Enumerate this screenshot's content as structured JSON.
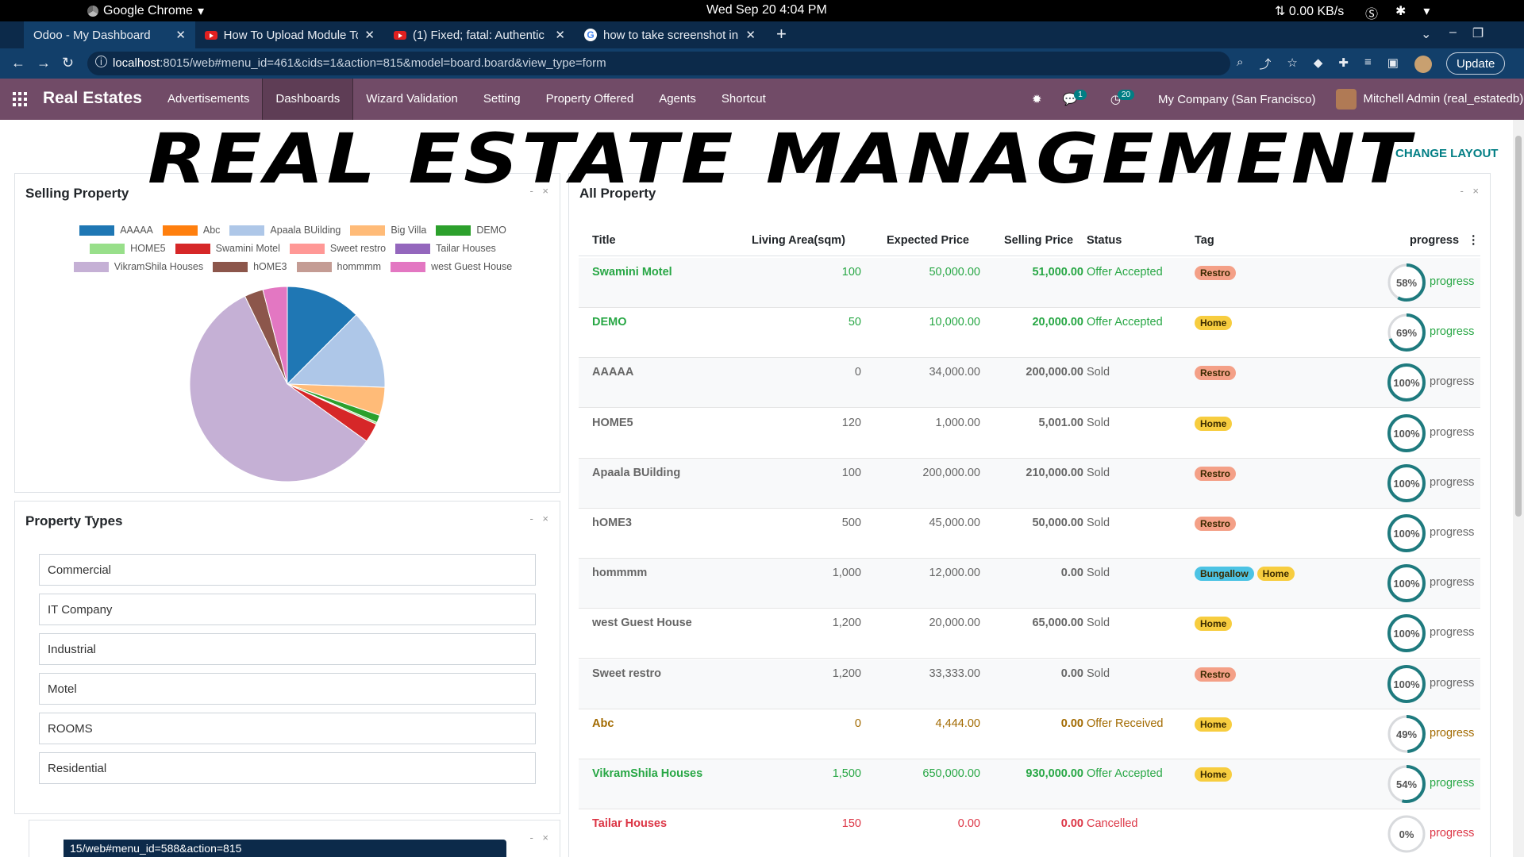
{
  "os": {
    "app_name": "Google Chrome",
    "clock": "Wed Sep 20   4:04 PM",
    "net_speed": "0.00 KB/s"
  },
  "browser": {
    "tabs": [
      {
        "title": "Odoo - My Dashboard",
        "icon": "odoo-icon",
        "active": true
      },
      {
        "title": "How To Upload Module To",
        "icon": "youtube-icon",
        "active": false
      },
      {
        "title": "(1) Fixed; fatal: Authentic",
        "icon": "youtube-icon",
        "active": false
      },
      {
        "title": "how to take screenshot in",
        "icon": "google-icon",
        "active": false
      }
    ],
    "url_host": "localhost",
    "url_rest": ":8015/web#menu_id=461&cids=1&action=815&model=board.board&view_type=form",
    "update_label": "Update"
  },
  "navbar": {
    "brand": "Real Estates",
    "menu": [
      "Advertisements",
      "Dashboards",
      "Wizard Validation",
      "Setting",
      "Property Offered",
      "Agents",
      "Shortcut"
    ],
    "active_menu": "Dashboards",
    "chat_badge": "1",
    "activity_badge": "20",
    "company": "My Company (San Francisco)",
    "user": "Mitchell Admin (real_estatedb)"
  },
  "overlay_title": "REAL ESTATE MANAGEMENT",
  "change_layout_label": "CHANGE LAYOUT",
  "selling_panel": {
    "title": "Selling Property",
    "controls": "- ×"
  },
  "chart_data": {
    "type": "pie",
    "title": "",
    "legend_position": "top",
    "categories": [
      "AAAAA",
      "Abc",
      "Apaala BUilding",
      "Big Villa",
      "DEMO",
      "HOME5",
      "Swamini Motel",
      "Sweet  restro",
      "Tailar Houses",
      "VikramShila Houses",
      "hOME3",
      "hommmm",
      "west Guest House"
    ],
    "values": [
      200000,
      0,
      210000,
      75000,
      20000,
      5001,
      51000,
      0,
      0,
      930000,
      50000,
      0,
      65000
    ],
    "colors": [
      "#1f77b4",
      "#ff7f0e",
      "#aec7e8",
      "#ffbb78",
      "#2ca02c",
      "#98df8a",
      "#d62728",
      "#ff9896",
      "#9467bd",
      "#c5b0d5",
      "#8c564b",
      "#c49c94",
      "#e377c2"
    ]
  },
  "types_panel": {
    "title": "Property Types",
    "controls": "- ×",
    "items": [
      "Commercial",
      "IT Company",
      "Industrial",
      "Motel",
      "ROOMS",
      "Residential"
    ]
  },
  "third_panel": {
    "controls": "- ×"
  },
  "all_panel": {
    "title": "All Property",
    "controls": "- ×",
    "columns": {
      "title": "Title",
      "living_area": "Living Area(sqm)",
      "expected_price": "Expected Price",
      "selling_price": "Selling Price",
      "status": "Status",
      "tag": "Tag",
      "progress": "progress"
    },
    "rows": [
      {
        "title": "Swamini Motel",
        "living_area": "100",
        "expected_price": "50,000.00",
        "selling_price": "51,000.00",
        "status": "Offer Accepted",
        "tags": [
          "Restro"
        ],
        "progress": 58,
        "progress_text": "58%",
        "progress_label": "progress",
        "tone": "green"
      },
      {
        "title": "DEMO",
        "living_area": "50",
        "expected_price": "10,000.00",
        "selling_price": "20,000.00",
        "status": "Offer Accepted",
        "tags": [
          "Home"
        ],
        "progress": 69,
        "progress_text": "69%",
        "progress_label": "progress",
        "tone": "green"
      },
      {
        "title": "AAAAA",
        "living_area": "0",
        "expected_price": "34,000.00",
        "selling_price": "200,000.00",
        "status": "Sold",
        "tags": [
          "Restro"
        ],
        "progress": 100,
        "progress_text": "100%",
        "progress_label": "progress",
        "tone": "grey"
      },
      {
        "title": "HOME5",
        "living_area": "120",
        "expected_price": "1,000.00",
        "selling_price": "5,001.00",
        "status": "Sold",
        "tags": [
          "Home"
        ],
        "progress": 100,
        "progress_text": "100%",
        "progress_label": "progress",
        "tone": "grey"
      },
      {
        "title": "Apaala BUilding",
        "living_area": "100",
        "expected_price": "200,000.00",
        "selling_price": "210,000.00",
        "status": "Sold",
        "tags": [
          "Restro"
        ],
        "progress": 100,
        "progress_text": "100%",
        "progress_label": "progress",
        "tone": "grey"
      },
      {
        "title": "hOME3",
        "living_area": "500",
        "expected_price": "45,000.00",
        "selling_price": "50,000.00",
        "status": "Sold",
        "tags": [
          "Restro"
        ],
        "progress": 100,
        "progress_text": "100%",
        "progress_label": "progress",
        "tone": "grey"
      },
      {
        "title": "hommmm",
        "living_area": "1,000",
        "expected_price": "12,000.00",
        "selling_price": "0.00",
        "status": "Sold",
        "tags": [
          "Bungallow",
          "Home"
        ],
        "progress": 100,
        "progress_text": "100%",
        "progress_label": "progress",
        "tone": "grey"
      },
      {
        "title": "west Guest House",
        "living_area": "1,200",
        "expected_price": "20,000.00",
        "selling_price": "65,000.00",
        "status": "Sold",
        "tags": [
          "Home"
        ],
        "progress": 100,
        "progress_text": "100%",
        "progress_label": "progress",
        "tone": "grey"
      },
      {
        "title": "Sweet restro",
        "living_area": "1,200",
        "expected_price": "33,333.00",
        "selling_price": "0.00",
        "status": "Sold",
        "tags": [
          "Restro"
        ],
        "progress": 100,
        "progress_text": "100%",
        "progress_label": "progress",
        "tone": "grey"
      },
      {
        "title": "Abc",
        "living_area": "0",
        "expected_price": "4,444.00",
        "selling_price": "0.00",
        "status": "Offer Received",
        "tags": [
          "Home"
        ],
        "progress": 49,
        "progress_text": "49%",
        "progress_label": "progress",
        "tone": "amber"
      },
      {
        "title": "VikramShila Houses",
        "living_area": "1,500",
        "expected_price": "650,000.00",
        "selling_price": "930,000.00",
        "status": "Offer Accepted",
        "tags": [
          "Home"
        ],
        "progress": 54,
        "progress_text": "54%",
        "progress_label": "progress",
        "tone": "green"
      },
      {
        "title": "Tailar Houses",
        "living_area": "150",
        "expected_price": "0.00",
        "selling_price": "0.00",
        "status": "Cancelled",
        "tags": [],
        "progress": 0,
        "progress_text": "0%",
        "progress_label": "progress",
        "tone": "red"
      }
    ]
  },
  "tag_colors": {
    "Restro": "#f4a087",
    "Home": "#f7cd3f",
    "Bungallow": "#4cc3e4"
  },
  "tone_colors": {
    "green": "#28a745",
    "grey": "#666666",
    "amber": "#a26a00",
    "red": "#dc3545"
  },
  "status_url": "15/web#menu_id=588&action=815"
}
